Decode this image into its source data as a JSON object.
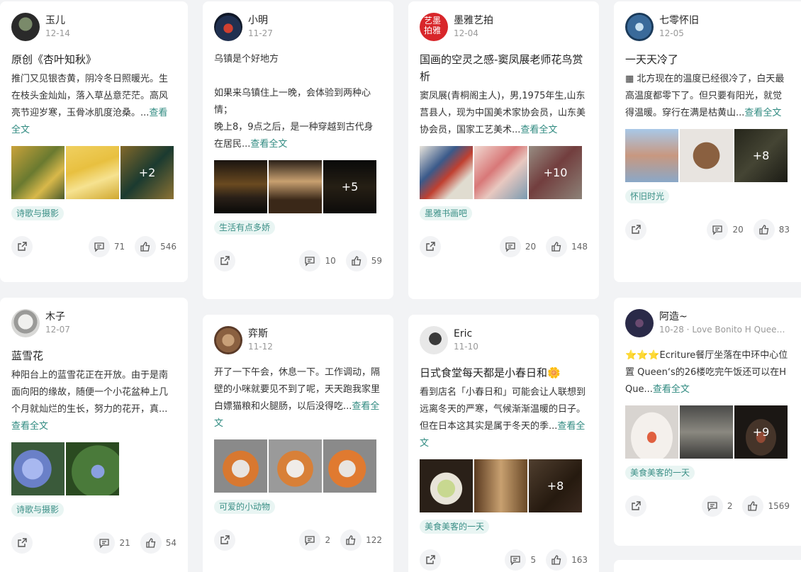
{
  "ui": {
    "more": "查看全文"
  },
  "cards": [
    {
      "author": "玉儿",
      "date": "12-14",
      "title": "原创《杏叶知秋》",
      "body": "推门又见银杏黄，阴冷冬日照暖光。生在枝头金灿灿，落入草丛意茫茫。高风亮节迎岁寒，玉骨冰肌度沧桑。...",
      "more_count": "+2",
      "tag": "诗歌与摄影",
      "comments": "71",
      "likes": "546"
    },
    {
      "author": "小明",
      "date": "11-27",
      "body": "乌镇是个好地方\n\n如果来乌镇住上一晚，会体验到两种心情；\n晚上8，9点之后，是一种穿越到古代身在居民...",
      "more_count": "+5",
      "tag": "生活有点多娇",
      "comments": "10",
      "likes": "59"
    },
    {
      "author": "墨雅艺拍",
      "date": "12-04",
      "title": "国画的空灵之感-窦凤展老师花鸟赏析",
      "body": "窦凤展(青桐阁主人)，男,1975年生,山东莒县人，现为中国美术家协会员，山东美协会员，国家工艺美术...",
      "more_count": "+10",
      "tag": "墨雅书画吧",
      "comments": "20",
      "likes": "148"
    },
    {
      "author": "七零怀旧",
      "date": "12-05",
      "title": "一天天冷了",
      "body": "▦ 北方现在的温度已经很冷了，白天最高温度都零下了。但只要有阳光，就觉得温暖。穿行在满是枯黄山...",
      "more_count": "+8",
      "tag": "怀旧时光",
      "comments": "20",
      "likes": "83"
    },
    {
      "author": "木子",
      "date": "12-07",
      "title": "蓝雪花",
      "body": "种阳台上的蓝雪花正在开放。由于是南面向阳的缘故，随便一个小花盆种上几个月就灿烂的生长，努力的花开，真...",
      "tag": "诗歌与摄影",
      "comments": "21",
      "likes": "54"
    },
    {
      "author": "弈斯",
      "date": "11-12",
      "body": "开了一下午会，休息一下。工作调动，隔壁的小咪就要见不到了呢，天天跑我家里白嫖猫粮和火腿肠，以后没得吃...",
      "tag": "可爱的小动物",
      "comments": "2",
      "likes": "122"
    },
    {
      "author": "Eric",
      "date": "11-10",
      "title": "日式食堂每天都是小春日和🌼",
      "body": "看到店名「小春日和」可能会让人联想到远离冬天的严寒，气候渐渐温暖的日子。但在日本这其实是属于冬天的季...",
      "more_count": "+8",
      "tag": "美食美客的一天",
      "comments": "5",
      "likes": "163"
    },
    {
      "author": "阿造~",
      "date": "10-28 · Love Bonito H Queen...",
      "body": "⭐⭐⭐Ecriture餐厅坐落在中环中心位置 Queen‘s的26楼吃完午饭还可以在H Que...",
      "more_count": "+9",
      "tag": "美食美客的一天",
      "comments": "2",
      "likes": "1569"
    }
  ]
}
